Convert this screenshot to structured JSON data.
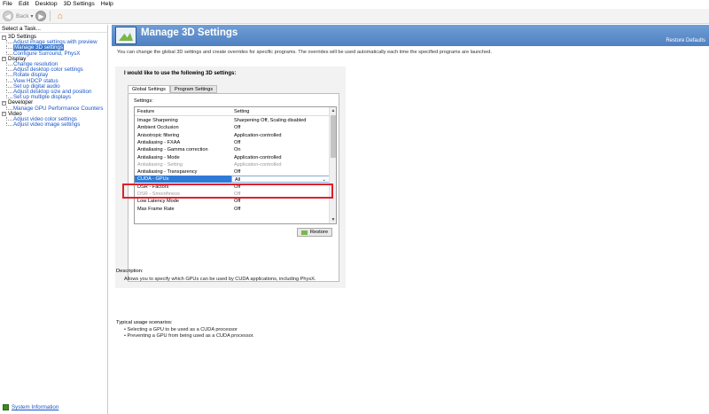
{
  "menu": [
    "File",
    "Edit",
    "Desktop",
    "3D Settings",
    "Help"
  ],
  "toolbar": {
    "back_label": "Back",
    "dropdown": "▾"
  },
  "left": {
    "header": "Select a Task...",
    "tree": [
      {
        "category": "3D Settings",
        "items": [
          "Adjust image settings with preview",
          "Manage 3D settings",
          "Configure Surround, PhysX"
        ]
      },
      {
        "category": "Display",
        "items": [
          "Change resolution",
          "Adjust desktop color settings",
          "Rotate display",
          "View HDCP status",
          "Set up digital audio",
          "Adjust desktop size and position",
          "Set up multiple displays"
        ]
      },
      {
        "category": "Developer",
        "items": [
          "Manage GPU Performance Counters"
        ]
      },
      {
        "category": "Video",
        "items": [
          "Adjust video color settings",
          "Adjust video image settings"
        ]
      }
    ],
    "selected_item": "Manage 3D settings",
    "system_info": "System Information"
  },
  "main": {
    "title": "Manage 3D Settings",
    "restore_defaults": "Restore Defaults",
    "intro": "You can change the global 3D settings and create overrides for specific programs. The overrides will be used automatically each time the specified programs are launched.",
    "heading": "I would like to use the following 3D settings:",
    "tabs": [
      "Global Settings",
      "Program Settings"
    ],
    "settings_label": "Settings:",
    "columns": [
      "Feature",
      "Setting"
    ],
    "rows": [
      {
        "feature": "Image Sharpening",
        "setting": "Sharpening Off, Scaling disabled",
        "state": "normal"
      },
      {
        "feature": "Ambient Occlusion",
        "setting": "Off",
        "state": "normal"
      },
      {
        "feature": "Anisotropic filtering",
        "setting": "Application-controlled",
        "state": "normal"
      },
      {
        "feature": "Antialiasing - FXAA",
        "setting": "Off",
        "state": "normal"
      },
      {
        "feature": "Antialiasing - Gamma correction",
        "setting": "On",
        "state": "normal"
      },
      {
        "feature": "Antialiasing - Mode",
        "setting": "Application-controlled",
        "state": "normal"
      },
      {
        "feature": "Antialiasing - Setting",
        "setting": "Application-controlled",
        "state": "disabled"
      },
      {
        "feature": "Antialiasing - Transparency",
        "setting": "Off",
        "state": "normal"
      },
      {
        "feature": "CUDA - GPUs",
        "setting": "All",
        "state": "selected"
      },
      {
        "feature": "DSR - Factors",
        "setting": "Off",
        "state": "normal"
      },
      {
        "feature": "DSR - Smoothness",
        "setting": "Off",
        "state": "disabled"
      },
      {
        "feature": "Low Latency Mode",
        "setting": "Off",
        "state": "normal"
      },
      {
        "feature": "Max Frame Rate",
        "setting": "Off",
        "state": "normal"
      }
    ],
    "restore_button": "Restore",
    "description_title": "Description:",
    "description": "Allows you to specify which GPUs can be used by CUDA applications, including PhysX.",
    "usage_title": "Typical usage scenarios:",
    "usage": [
      "Selecting a GPU to be used as a CUDA processor",
      "Preventing a GPU from being used as a CUDA processor."
    ]
  },
  "colors": {
    "banner": "#5b8cca",
    "selection": "#2f7ad6",
    "highlight_box": "#e0202a",
    "link": "#1a55c8"
  }
}
